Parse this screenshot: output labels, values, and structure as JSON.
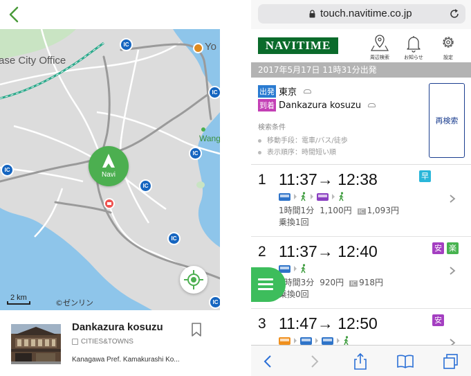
{
  "left_app": {
    "map": {
      "labels": {
        "city_office": "ase City Office",
        "yo": "Yo",
        "wang": "Wang"
      },
      "ic_label": "IC",
      "navi_label": "Navi",
      "scale": "2 km",
      "copyright": "©ゼンリン"
    },
    "place": {
      "name": "Dankazura kosuzu",
      "category": "CITIES&TOWNS",
      "address": "Kanagawa Pref. Kamakurashi Ko..."
    }
  },
  "right_app": {
    "url": "touch.navitime.co.jp",
    "logo": "NAVITIME",
    "header_buttons": [
      {
        "label": "周辺検索",
        "icon": "map-pin-icon"
      },
      {
        "label": "お知らせ",
        "icon": "bell-icon"
      },
      {
        "label": "設定",
        "icon": "gear-icon"
      }
    ],
    "date_bar": "2017年5月17日 11時31分出発",
    "origin": {
      "tag": "出発",
      "name": "東京"
    },
    "destination": {
      "tag": "到着",
      "name": "Dankazura kosuzu"
    },
    "research_button": "再検索",
    "conditions": {
      "title": "検索条件",
      "items": [
        "移動手段：電車/バス/徒歩",
        "表示順序：時間短い順"
      ]
    },
    "ic_tag": "IC",
    "routes": [
      {
        "num": "1",
        "times": "11:37→ 12:38",
        "duration": "1時間1分",
        "fare": "1,100円",
        "ic_fare": "1,093円",
        "transfers": "乗換1回",
        "badges": [
          {
            "text": "早",
            "color": "#29b6d9"
          }
        ]
      },
      {
        "num": "2",
        "times": "11:37→ 12:40",
        "duration": "1時間3分",
        "fare": "920円",
        "ic_fare": "918円",
        "transfers": "乗換0回",
        "badges": [
          {
            "text": "安",
            "color": "#a43fc1"
          },
          {
            "text": "楽",
            "color": "#47b34f"
          }
        ]
      },
      {
        "num": "3",
        "times": "11:47→ 12:50",
        "duration": "",
        "fare": "",
        "ic_fare": "",
        "transfers": "",
        "badges": [
          {
            "text": "安",
            "color": "#a43fc1"
          }
        ]
      }
    ],
    "colors": {
      "logo": "#0a6b2b",
      "origin_tag": "#2a7bd1",
      "destination_tag": "#c33fb5",
      "fab": "#3dbd5c"
    }
  }
}
